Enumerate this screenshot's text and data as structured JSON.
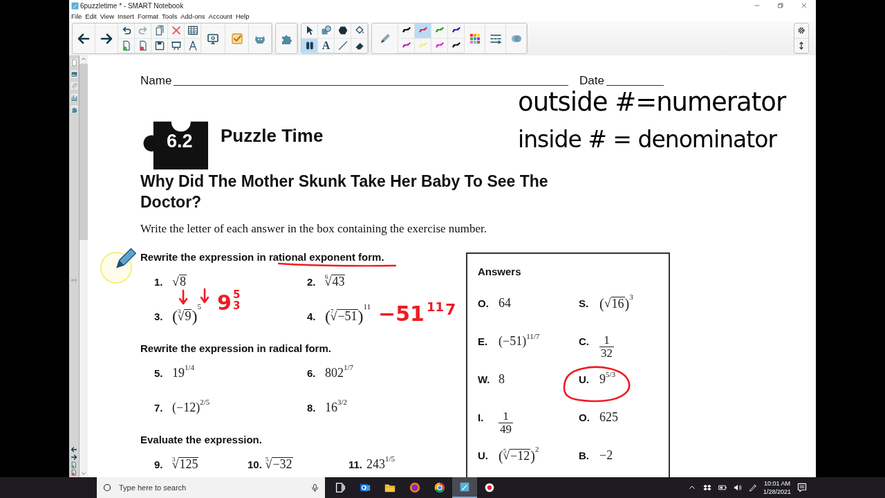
{
  "window": {
    "title": "6puzzletime * - SMART Notebook"
  },
  "menu": [
    "File",
    "Edit",
    "View",
    "Insert",
    "Format",
    "Tools",
    "Add-ons",
    "Account",
    "Help"
  ],
  "toolbar_groups": [
    {
      "buttons": [
        {
          "selected": false
        },
        {
          "selected": false
        },
        {
          "selected": false
        },
        {
          "selected": false
        },
        {
          "selected": false
        },
        {
          "selected": false
        },
        {
          "selected": false
        },
        {
          "selected": false
        },
        {
          "selected": false
        },
        {
          "selected": false
        },
        {
          "selected": false
        },
        {
          "selected": false
        },
        {
          "selected": false
        },
        {
          "selected": false
        },
        {
          "selected": false
        }
      ]
    },
    {
      "buttons": [
        {
          "selected": false
        }
      ]
    },
    {
      "buttons": [
        {
          "selected": false
        },
        {
          "selected": true
        },
        {
          "selected": false
        },
        {
          "selected": false,
          "label": "A"
        },
        {
          "selected": false
        },
        {
          "selected": false
        },
        {
          "selected": false
        },
        {
          "selected": false
        }
      ]
    },
    {
      "buttons": [
        {
          "selected": false
        },
        {
          "selected": false,
          "color": "#111111"
        },
        {
          "selected": false,
          "color": "#c02cc0"
        },
        {
          "selected": true,
          "color": "#e0305a"
        },
        {
          "selected": false,
          "color": "#f2ee70"
        },
        {
          "selected": false,
          "color": "#30a030"
        },
        {
          "selected": false,
          "color": "#e030d8"
        },
        {
          "selected": false,
          "color": "#4a20b8"
        },
        {
          "selected": false,
          "color": "#222222"
        },
        {
          "selected": false
        },
        {
          "selected": false
        },
        {
          "selected": false
        }
      ]
    }
  ],
  "worksheet": {
    "name_label": "Name",
    "date_label": "Date",
    "badge": "6.2",
    "title": "Puzzle Time",
    "question": "Why Did The Mother Skunk Take Her Baby To See The Doctor?",
    "instruction": "Write the letter of each answer in the box containing the exercise number.",
    "sections": [
      {
        "heading": "Rewrite the expression in rational exponent form.",
        "exercises": [
          {
            "number": "1.",
            "expr": {
              "kind": "radical",
              "sign": "√",
              "radicand": "8"
            }
          },
          {
            "number": "2.",
            "expr": {
              "kind": "radical",
              "index": "6",
              "sign": "√",
              "radicand": "43"
            }
          },
          {
            "number": "3.",
            "expr": {
              "kind": "radical",
              "open": "(",
              "index": "3",
              "sign": "√",
              "radicand": "9",
              "close": ")",
              "exp": "5"
            }
          },
          {
            "number": "4.",
            "expr": {
              "kind": "radical",
              "open": "(",
              "index": "7",
              "sign": "√",
              "radicand": "−51",
              "close": ")",
              "exp": "11"
            }
          }
        ]
      },
      {
        "heading": "Rewrite the expression in radical form.",
        "exercises": [
          {
            "number": "5.",
            "expr": {
              "kind": "power",
              "base": "19",
              "exp": "1/4"
            }
          },
          {
            "number": "6.",
            "expr": {
              "kind": "power",
              "base": "802",
              "exp": "1/7"
            }
          },
          {
            "number": "7.",
            "expr": {
              "kind": "power",
              "base": "(−12)",
              "exp": "2/5"
            }
          },
          {
            "number": "8.",
            "expr": {
              "kind": "power",
              "base": "16",
              "exp": "3/2"
            }
          }
        ]
      },
      {
        "heading": "Evaluate the expression.",
        "exercises": [
          {
            "number": "9.",
            "expr": {
              "kind": "radical",
              "index": "3",
              "sign": "√",
              "radicand": "125"
            }
          },
          {
            "number": "10.",
            "expr": {
              "kind": "radical",
              "index": "5",
              "sign": "√",
              "radicand": "−32"
            }
          },
          {
            "number": "11.",
            "expr": {
              "kind": "power",
              "base": "243",
              "exp": "1/5"
            }
          }
        ]
      }
    ],
    "answers": {
      "title": "Answers",
      "items": [
        {
          "letter": "O.",
          "expr": {
            "kind": "number",
            "text": "64"
          }
        },
        {
          "letter": "S.",
          "expr": {
            "kind": "radical",
            "open": "(",
            "sign": "√",
            "radicand": "16",
            "close": ")",
            "exp": "3"
          }
        },
        {
          "letter": "E.",
          "expr": {
            "kind": "power",
            "base": "(−51)",
            "exp": "11/7"
          }
        },
        {
          "letter": "C.",
          "expr": {
            "kind": "fraction",
            "num": "1",
            "den": "32"
          }
        },
        {
          "letter": "W.",
          "expr": {
            "kind": "number",
            "text": "8"
          }
        },
        {
          "letter": "U.",
          "expr": {
            "kind": "power",
            "base": "9",
            "exp": "5/3"
          }
        },
        {
          "letter": "I.",
          "expr": {
            "kind": "fraction",
            "num": "1",
            "den": "49"
          }
        },
        {
          "letter": "O.",
          "expr": {
            "kind": "number",
            "text": "625"
          }
        },
        {
          "letter": "U.",
          "expr": {
            "kind": "radical",
            "open": "(",
            "index": "5",
            "sign": "√",
            "radicand": "−12",
            "close": ")",
            "exp": "2"
          }
        },
        {
          "letter": "B.",
          "expr": {
            "kind": "number",
            "text": "−2"
          }
        }
      ]
    }
  },
  "ink": [
    {
      "kind": "text",
      "text": "outside #=numerator",
      "color": "#000000"
    },
    {
      "kind": "text",
      "text": "inside # = denominator",
      "color": "#000000"
    },
    {
      "kind": "underline",
      "color": "#ee1c24"
    },
    {
      "kind": "arrow",
      "color": "#ee1c24"
    },
    {
      "kind": "arrow",
      "color": "#ee1c24"
    },
    {
      "kind": "stacked",
      "base": "9",
      "num": "5",
      "den": "3",
      "color": "#ee1c24"
    },
    {
      "kind": "raised",
      "base": "−51",
      "num": "11",
      "den": "7",
      "color": "#ee1c24"
    },
    {
      "kind": "circle",
      "color": "#ee1c24"
    }
  ],
  "taskbar": {
    "search": {
      "placeholder": "Type here to search"
    },
    "apps": [
      {
        "selected": false
      },
      {
        "selected": false
      },
      {
        "selected": false
      },
      {
        "selected": false
      },
      {
        "selected": false
      },
      {
        "selected": true
      },
      {
        "selected": false
      }
    ],
    "time": "10:01 AM",
    "date": "1/28/2021"
  }
}
